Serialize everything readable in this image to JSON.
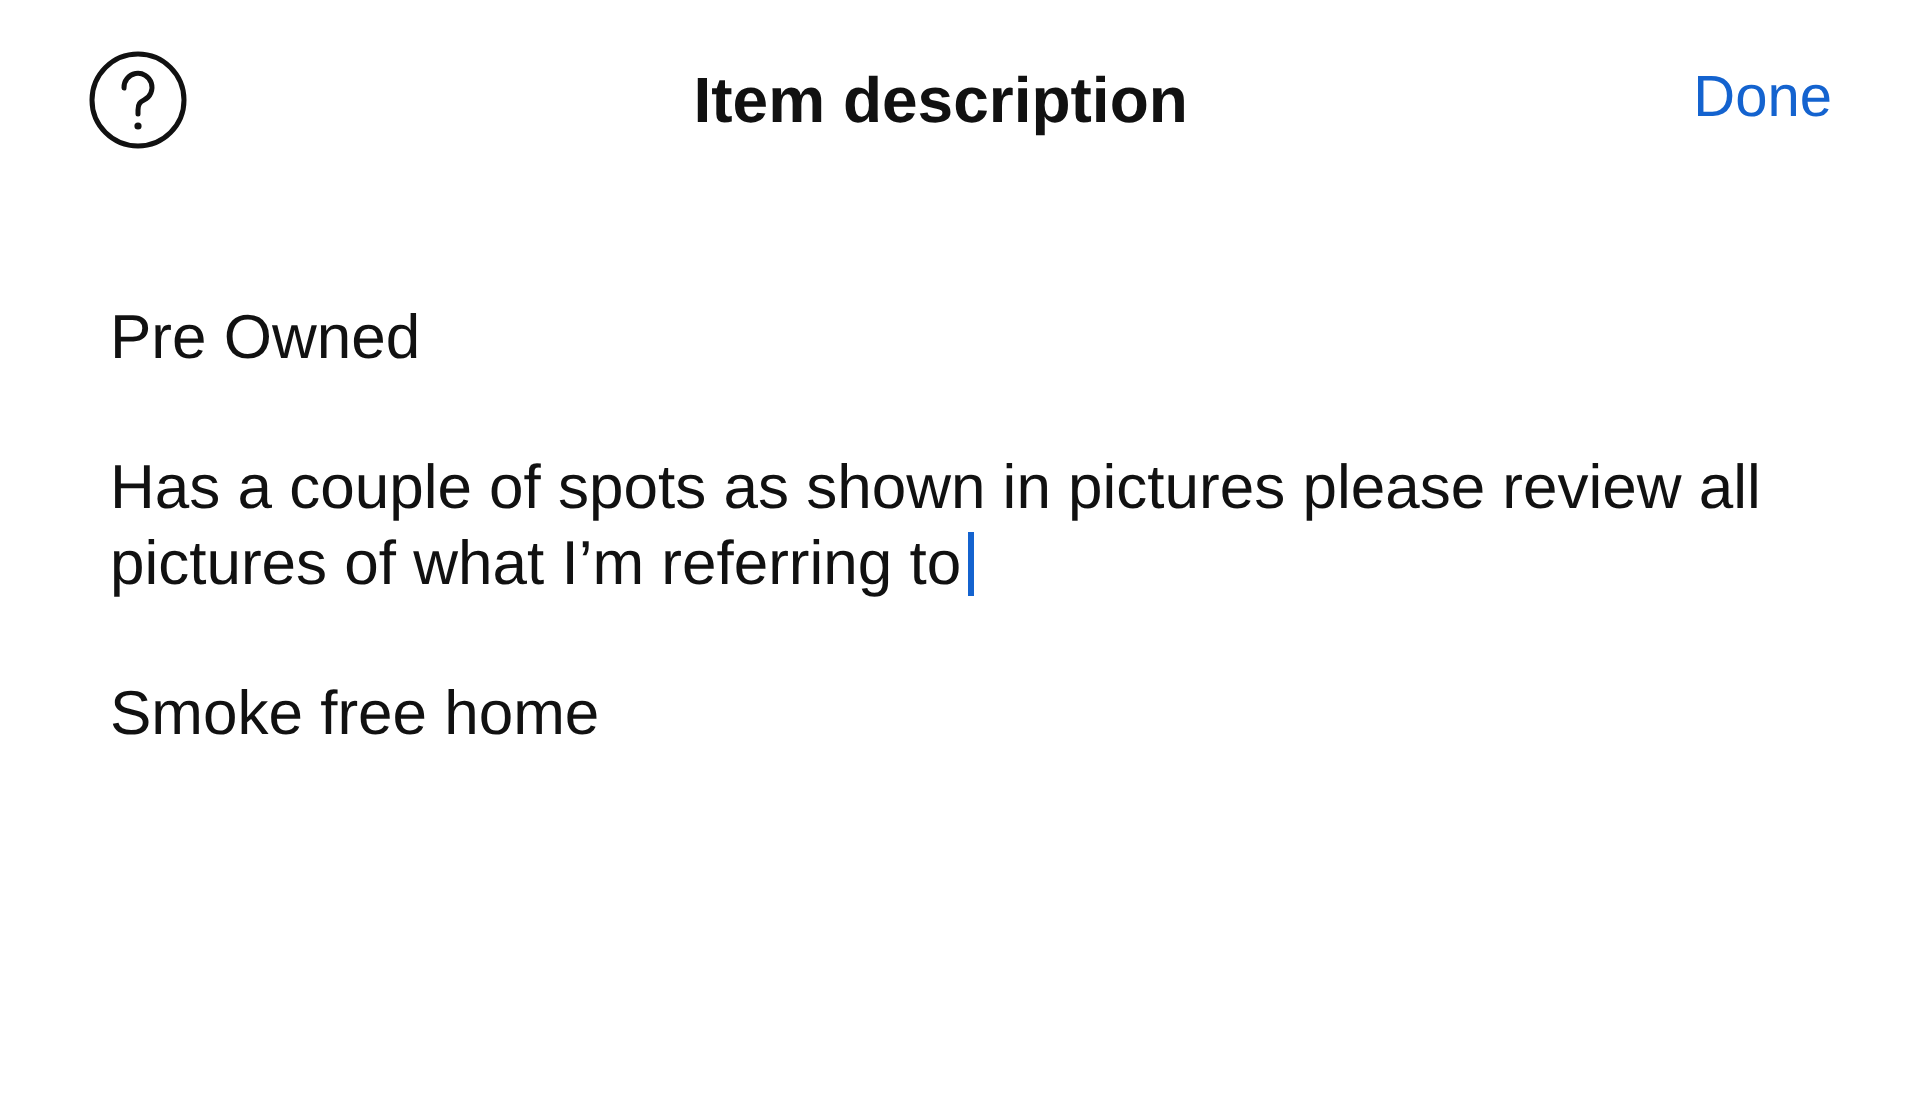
{
  "header": {
    "title": "Item description",
    "done": "Done"
  },
  "description": {
    "paragraphs": [
      {
        "text": "Pre Owned",
        "has_cursor": false
      },
      {
        "text": "Has a couple of spots as shown in pictures please review all pictures of what I’m referring to",
        "has_cursor": true
      },
      {
        "text": "Smoke free home",
        "has_cursor": false
      }
    ]
  }
}
